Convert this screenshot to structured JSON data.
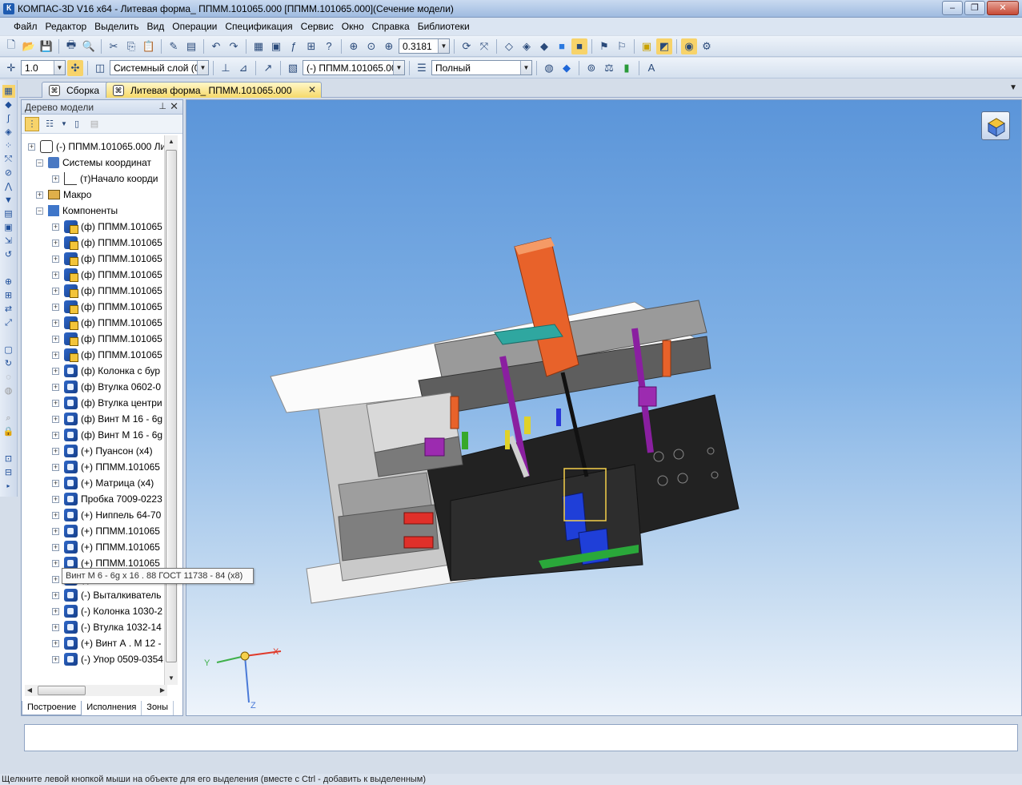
{
  "window": {
    "title": "КОМПАС-3D V16  x64 - Литевая форма_ ППММ.101065.000 [ППММ.101065.000](Сечение модели)",
    "app_icon_letter": "К"
  },
  "menu": [
    "Файл",
    "Редактор",
    "Выделить",
    "Вид",
    "Операции",
    "Спецификация",
    "Сервис",
    "Окно",
    "Справка",
    "Библиотеки"
  ],
  "toolbar1": {
    "zoom_value": "0.3181"
  },
  "toolbar2": {
    "step_value": "1.0",
    "layer": "Системный слой (0)",
    "component": "(-) ППММ.101065.00",
    "view_mode": "Полный"
  },
  "tabs": [
    {
      "label": "Сборка"
    },
    {
      "label": "Литевая форма_ ППММ.101065.000",
      "active": true
    }
  ],
  "tree_panel": {
    "title": "Дерево модели",
    "nodes": [
      {
        "label": "(-) ППММ.101065.000 Лить",
        "level": 0,
        "icon": "root"
      },
      {
        "label": "Системы координат",
        "level": 1,
        "icon": "sys"
      },
      {
        "label": "(т)Начало коорди",
        "level": 2,
        "icon": "origin"
      },
      {
        "label": "Макро",
        "level": 1,
        "icon": "macro"
      },
      {
        "label": "Компоненты",
        "level": 1,
        "icon": "comps"
      },
      {
        "label": "(ф) ППММ.101065",
        "level": 2,
        "icon": "compy"
      },
      {
        "label": "(ф) ППММ.101065",
        "level": 2,
        "icon": "compy"
      },
      {
        "label": "(ф) ППММ.101065",
        "level": 2,
        "icon": "compy"
      },
      {
        "label": "(ф) ППММ.101065",
        "level": 2,
        "icon": "compy"
      },
      {
        "label": "(ф) ППММ.101065",
        "level": 2,
        "icon": "compy"
      },
      {
        "label": "(ф) ППММ.101065",
        "level": 2,
        "icon": "compy"
      },
      {
        "label": "(ф) ППММ.101065",
        "level": 2,
        "icon": "compy"
      },
      {
        "label": "(ф) ППММ.101065",
        "level": 2,
        "icon": "compy"
      },
      {
        "label": "(ф) ППММ.101065",
        "level": 2,
        "icon": "compy"
      },
      {
        "label": "(ф) Колонка с бур",
        "level": 2,
        "icon": "comp"
      },
      {
        "label": "(ф) Втулка 0602-0",
        "level": 2,
        "icon": "comp"
      },
      {
        "label": "(ф) Втулка центри",
        "level": 2,
        "icon": "comp"
      },
      {
        "label": "(ф) Винт М 16 - 6g",
        "level": 2,
        "icon": "comp"
      },
      {
        "label": "(ф) Винт М 16 - 6g",
        "level": 2,
        "icon": "comp"
      },
      {
        "label": "(+) Пуансон (x4)",
        "level": 2,
        "icon": "comp"
      },
      {
        "label": "(+) ППММ.101065",
        "level": 2,
        "icon": "comp"
      },
      {
        "label": "(+) Матрица (x4)",
        "level": 2,
        "icon": "comp"
      },
      {
        "label": "Пробка 7009-0223",
        "level": 2,
        "icon": "comp"
      },
      {
        "label": "(+) Ниппель 64-70",
        "level": 2,
        "icon": "comp"
      },
      {
        "label": "(+) ППММ.101065",
        "level": 2,
        "icon": "comp"
      },
      {
        "label": "(+) ППММ.101065",
        "level": 2,
        "icon": "comp"
      },
      {
        "label": "(+) ППММ.101065",
        "level": 2,
        "icon": "comp"
      },
      {
        "label": "(-) Выталкиватель",
        "level": 2,
        "icon": "comp"
      },
      {
        "label": "(-) Выталкиватель",
        "level": 2,
        "icon": "comp"
      },
      {
        "label": "(-) Колонка 1030-2",
        "level": 2,
        "icon": "comp"
      },
      {
        "label": "(-) Втулка 1032-14",
        "level": 2,
        "icon": "comp"
      },
      {
        "label": "(+) Винт А . М 12 -",
        "level": 2,
        "icon": "comp"
      },
      {
        "label": "(-) Упор 0509-0354",
        "level": 2,
        "icon": "comp"
      }
    ],
    "tooltip": "Винт М 6 - 6g x 16 . 88 ГОСТ 11738 - 84 (x8)",
    "bottom_tabs": [
      "Построение",
      "Исполнения",
      "Зоны"
    ]
  },
  "viewport": {
    "axis_labels": {
      "x": "X",
      "y": "Y",
      "z": "Z"
    }
  },
  "status": {
    "hint": "Щелкните левой кнопкой мыши на объекте для его выделения (вместе с Ctrl - добавить к выделенным)"
  },
  "colors": {
    "tab_active": "#f6d96a",
    "viewport_top": "#5b95d9",
    "part_orange": "#e8622a",
    "part_blue": "#1f3fd8",
    "part_purple": "#8a1fa0"
  }
}
